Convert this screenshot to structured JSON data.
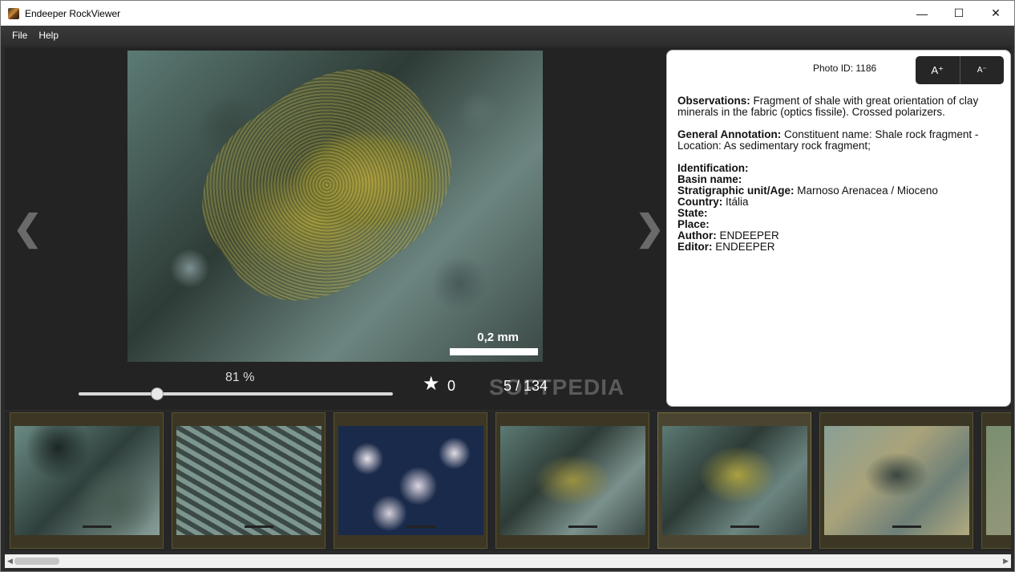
{
  "window": {
    "title": "Endeeper RockViewer",
    "minimize_glyph": "—",
    "maximize_glyph": "☐",
    "close_glyph": "✕"
  },
  "menu": [
    "File",
    "Help"
  ],
  "viewer": {
    "scale_label": "0,2 mm",
    "zoom": "81 %",
    "zoom_value": 0.25,
    "favorites": "0",
    "counter": "5 / 134",
    "prev_glyph": "❮",
    "next_glyph": "❯",
    "star_glyph": "★"
  },
  "info": {
    "photo_id": "Photo ID: 1186",
    "font_increase": "A⁺",
    "font_decrease": "A⁻",
    "observations_label": "Observations:",
    "observations_text": "Fragment of shale with great orientation of clay minerals in the fabric (optics fissile). Crossed polarizers.",
    "annotation_label": "General Annotation:",
    "annotation_text": "Constituent name: Shale rock fragment - Location: As sedimentary rock fragment;",
    "fields": [
      {
        "label": "Identification:",
        "value": ""
      },
      {
        "label": "Basin name:",
        "value": ""
      },
      {
        "label": "Stratigraphic unit/Age:",
        "value": "Marnoso Arenacea / Mioceno"
      },
      {
        "label": "Country:",
        "value": "Itália"
      },
      {
        "label": "State:",
        "value": ""
      },
      {
        "label": "Place:",
        "value": ""
      },
      {
        "label": "Author:",
        "value": "ENDEEPER"
      },
      {
        "label": "Editor:",
        "value": "ENDEEPER"
      }
    ]
  },
  "watermark": "SOFTPEDIA",
  "thumbnails": [
    {
      "id": 1,
      "active": false
    },
    {
      "id": 2,
      "active": false
    },
    {
      "id": 3,
      "active": false
    },
    {
      "id": 4,
      "active": false
    },
    {
      "id": 5,
      "active": true
    },
    {
      "id": 6,
      "active": false
    },
    {
      "id": 7,
      "active": false
    }
  ],
  "icons": {
    "app": "rock-app-icon",
    "prev": "chevron-left-icon",
    "next": "chevron-right-icon",
    "favorite": "star-icon"
  }
}
